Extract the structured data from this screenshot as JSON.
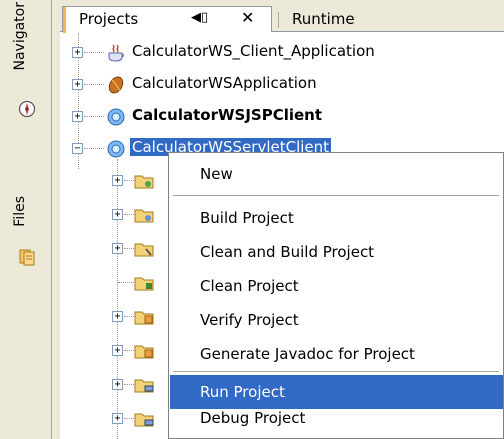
{
  "side": {
    "navigator_label": "Navigator",
    "files_label": "Files"
  },
  "tabs": {
    "projects_label": "Projects",
    "minimize_glyph": "◀▯",
    "close_glyph": "✕",
    "runtime_label": "Runtime"
  },
  "tree": [
    {
      "label": "CalculatorWS_Client_Application",
      "icon": "java-cup-icon"
    },
    {
      "label": "CalculatorWSApplication",
      "icon": "bean-icon"
    },
    {
      "label": "CalculatorWSJSPClient",
      "icon": "web-globe-icon",
      "bold": true
    },
    {
      "label": "CalculatorWSServletClient",
      "icon": "web-globe-icon",
      "selected": true
    }
  ],
  "menu": {
    "items": [
      {
        "label": "New"
      },
      {
        "label": "Build Project"
      },
      {
        "label": "Clean and Build Project"
      },
      {
        "label": "Clean Project"
      },
      {
        "label": "Verify Project"
      },
      {
        "label": "Generate Javadoc for Project"
      },
      {
        "label": "Run Project",
        "highlight": true
      },
      {
        "label": "Debug Project"
      }
    ]
  },
  "colors": {
    "selection": "#316ac5",
    "tab_accent": "#f7b44a"
  }
}
